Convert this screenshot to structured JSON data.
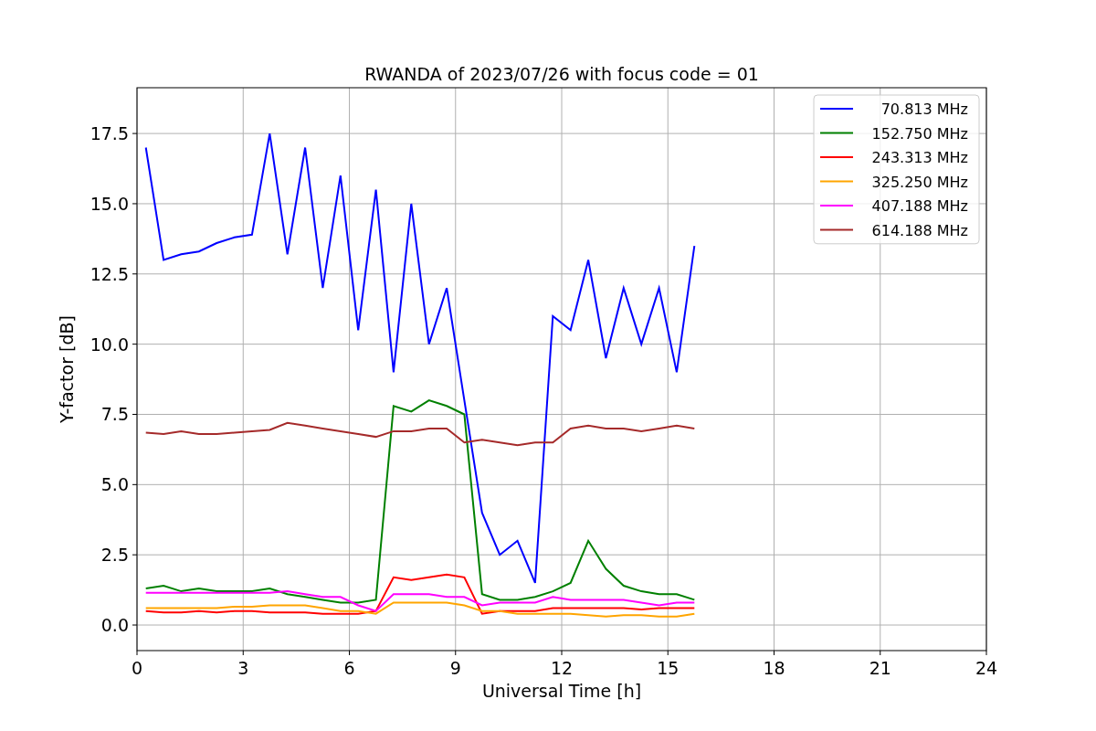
{
  "chart": {
    "chart_data": {
      "type": "line",
      "title": "RWANDA of 2023/07/26 with focus code = 01",
      "xlabel": "Universal Time [h]",
      "ylabel": "Y-factor [dB]",
      "x": [
        0.25,
        0.75,
        1.25,
        1.75,
        2.25,
        2.75,
        3.25,
        3.75,
        4.25,
        4.75,
        5.25,
        5.75,
        6.25,
        6.75,
        7.25,
        7.75,
        8.25,
        8.75,
        9.25,
        9.75,
        10.25,
        10.75,
        11.25,
        11.75,
        12.25,
        12.75,
        13.25,
        13.75,
        14.25,
        14.75,
        15.25,
        15.75
      ],
      "series": [
        {
          "name": "70.813 MHz",
          "color": "#0000ff",
          "values": [
            17,
            13,
            13.2,
            13.3,
            13.6,
            13.8,
            13.9,
            17.5,
            13.2,
            17,
            12,
            16,
            10.5,
            15.5,
            9,
            15,
            10,
            12,
            8,
            4,
            2.5,
            3,
            1.5,
            11,
            10.5,
            13,
            9.5,
            12,
            10,
            12,
            9,
            13.5
          ]
        },
        {
          "name": "152.750 MHz",
          "color": "#008000",
          "values": [
            1.3,
            1.4,
            1.2,
            1.3,
            1.2,
            1.2,
            1.2,
            1.3,
            1.1,
            1.0,
            0.9,
            0.8,
            0.8,
            0.9,
            7.8,
            7.6,
            8,
            7.8,
            7.5,
            1.1,
            0.9,
            0.9,
            1.0,
            1.2,
            1.5,
            3,
            2,
            1.4,
            1.2,
            1.1,
            1.1,
            0.9
          ]
        },
        {
          "name": "243.313 MHz",
          "color": "#ff0000",
          "values": [
            0.5,
            0.45,
            0.45,
            0.5,
            0.45,
            0.5,
            0.5,
            0.45,
            0.45,
            0.45,
            0.4,
            0.4,
            0.4,
            0.5,
            1.7,
            1.6,
            1.7,
            1.8,
            1.7,
            0.4,
            0.5,
            0.5,
            0.5,
            0.6,
            0.6,
            0.6,
            0.6,
            0.6,
            0.55,
            0.6,
            0.6,
            0.6
          ]
        },
        {
          "name": "325.250 MHz",
          "color": "#ffa500",
          "values": [
            0.6,
            0.6,
            0.6,
            0.6,
            0.6,
            0.65,
            0.65,
            0.7,
            0.7,
            0.7,
            0.6,
            0.5,
            0.5,
            0.4,
            0.8,
            0.8,
            0.8,
            0.8,
            0.7,
            0.5,
            0.5,
            0.4,
            0.4,
            0.4,
            0.4,
            0.35,
            0.3,
            0.35,
            0.35,
            0.3,
            0.3,
            0.4
          ]
        },
        {
          "name": "407.188 MHz",
          "color": "#ff00ff",
          "values": [
            1.15,
            1.15,
            1.15,
            1.15,
            1.15,
            1.15,
            1.15,
            1.15,
            1.2,
            1.1,
            1.0,
            1.0,
            0.7,
            0.5,
            1.1,
            1.1,
            1.1,
            1.0,
            1.0,
            0.7,
            0.8,
            0.8,
            0.8,
            1.0,
            0.9,
            0.9,
            0.9,
            0.9,
            0.8,
            0.7,
            0.8,
            0.8
          ]
        },
        {
          "name": "614.188 MHz",
          "color": "#a52a2a",
          "values": [
            6.85,
            6.8,
            6.9,
            6.8,
            6.8,
            6.85,
            6.9,
            6.95,
            7.2,
            7.1,
            7.0,
            6.9,
            6.8,
            6.7,
            6.9,
            6.9,
            7.0,
            7.0,
            6.5,
            6.6,
            6.5,
            6.4,
            6.5,
            6.5,
            7.0,
            7.1,
            7.0,
            7.0,
            6.9,
            7.0,
            7.1,
            7.0
          ]
        }
      ],
      "grid": true,
      "legend": true,
      "xlim": [
        0,
        24
      ],
      "ylim": [
        -0.91,
        19.13
      ],
      "xticks": [
        0,
        3,
        6,
        9,
        12,
        15,
        18,
        21,
        24
      ],
      "yticks": [
        {
          "value": 0,
          "label": "0.0"
        },
        {
          "value": 2.5,
          "label": "2.5"
        },
        {
          "value": 5,
          "label": "5.0"
        },
        {
          "value": 7.5,
          "label": "7.5"
        },
        {
          "value": 10,
          "label": "10.0"
        },
        {
          "value": 12.5,
          "label": "12.5"
        },
        {
          "value": 15,
          "label": "15.0"
        },
        {
          "value": 17.5,
          "label": "17.5"
        }
      ]
    }
  }
}
